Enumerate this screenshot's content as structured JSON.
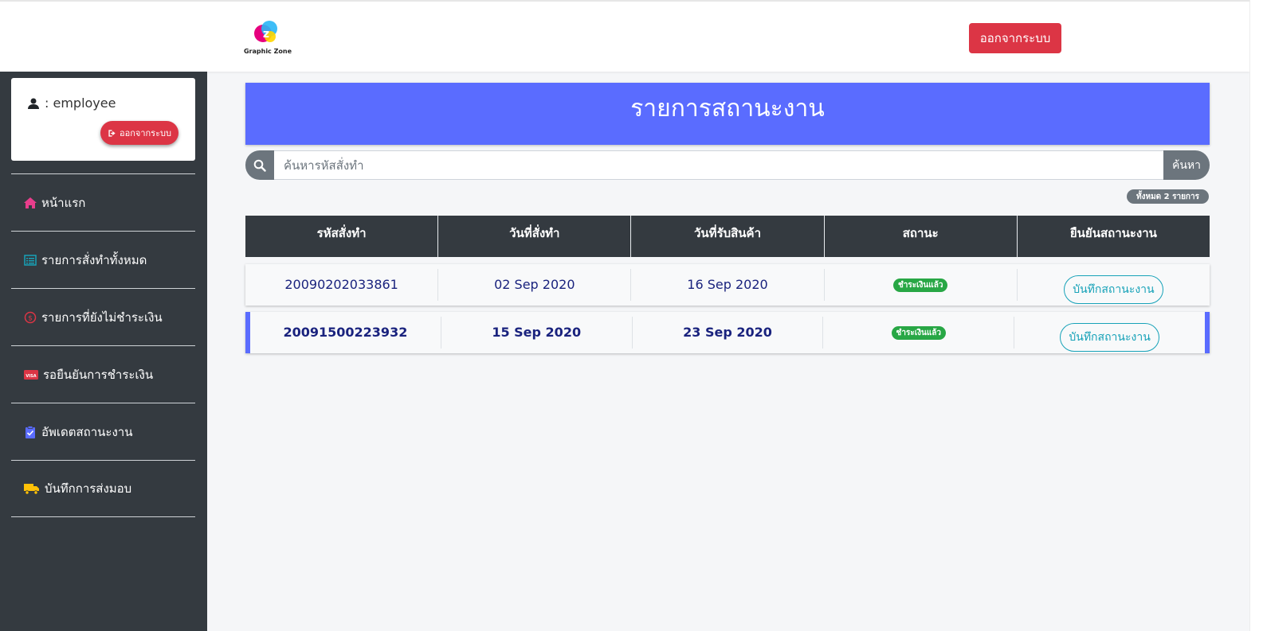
{
  "brand": {
    "name": "Graphic Zone"
  },
  "topbar": {
    "logout_label": "ออกจากระบบ"
  },
  "sidebar": {
    "user_label": ": employee",
    "logout_label": "ออกจากระบบ",
    "items": [
      {
        "label": "หน้าแรก",
        "icon": "home-icon",
        "color": "#e83e8c"
      },
      {
        "label": "รายการสั่งทำทั้งหมด",
        "icon": "list-icon",
        "color": "#17a2b8"
      },
      {
        "label": "รายการที่ยังไม่ชำระเงิน",
        "icon": "money-icon",
        "color": "#dc3545"
      },
      {
        "label": "รอยืนยันการชำระเงิน",
        "icon": "card-icon",
        "color": "#dc3545"
      },
      {
        "label": "อัพเดตสถานะงาน",
        "icon": "clipboard-check-icon",
        "color": "#5a6cff"
      },
      {
        "label": "บันทึกการส่งมอบ",
        "icon": "truck-icon",
        "color": "#ffc107"
      }
    ]
  },
  "main": {
    "title": "รายการสถานะงาน",
    "search": {
      "placeholder": "ค้นหารหัสสั่งทำ",
      "button_label": "ค้นหา"
    },
    "total_label": "ทั้งหมด 2 รายการ",
    "columns": [
      "รหัสสั่งทำ",
      "วันที่สั่งทำ",
      "วันที่รับสินค้า",
      "สถานะ",
      "ยืนยันสถานะงาน"
    ],
    "rows": [
      {
        "order_id": "20090202033861",
        "order_date": "02 Sep 2020",
        "receive_date": "16 Sep 2020",
        "status": "ชำระเงินแล้ว",
        "action": "บันทึกสถานะงาน"
      },
      {
        "order_id": "20091500223932",
        "order_date": "15 Sep 2020",
        "receive_date": "23 Sep 2020",
        "status": "ชำระเงินแล้ว",
        "action": "บันทึกสถานะงาน"
      }
    ]
  },
  "colors": {
    "accent": "#5a6cff",
    "danger": "#dc3545",
    "sidebar_bg": "#343a40",
    "success": "#28a745"
  }
}
